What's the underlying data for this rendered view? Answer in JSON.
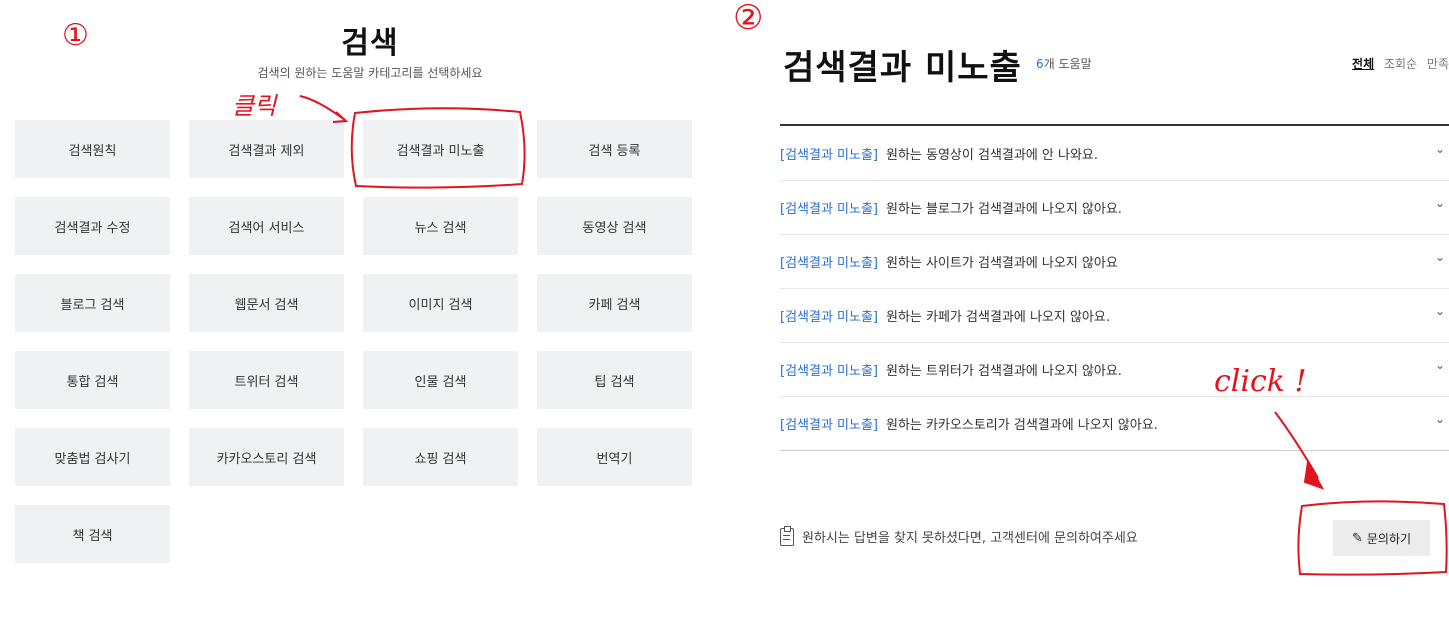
{
  "left": {
    "title": "검색",
    "subtitle": "검색의 원하는 도움말 카테고리를 선택하세요",
    "categories": [
      "검색원칙",
      "검색결과 제외",
      "검색결과 미노출",
      "검색 등록",
      "검색결과 수정",
      "검색어 서비스",
      "뉴스 검색",
      "동영상 검색",
      "블로그 검색",
      "웹문서 검색",
      "이미지 검색",
      "카페 검색",
      "통합 검색",
      "트위터 검색",
      "인물 검색",
      "팁 검색",
      "맞춤법 검사기",
      "카카오스토리 검색",
      "쇼핑 검색",
      "번역기",
      "책 검색"
    ]
  },
  "right": {
    "title": "검색결과 미노출",
    "count_number": "6",
    "count_suffix": "개 도움말",
    "sort": [
      "전체",
      "조회순",
      "만족"
    ],
    "tag": "[검색결과 미노출]",
    "items": [
      "원하는 동영상이 검색결과에 안 나와요.",
      "원하는 블로그가 검색결과에 나오지 않아요.",
      "원하는 사이트가 검색결과에 나오지 않아요",
      "원하는 카페가 검색결과에 나오지 않아요.",
      "원하는 트위터가 검색결과에 나오지 않아요.",
      "원하는 카카오스토리가 검색결과에 나오지 않아요."
    ],
    "help_text": "원하시는 답변을 찾지 못하셨다면, 고객센터에 문의하여주세요",
    "ask_button": "문의하기"
  },
  "annotations": {
    "step1": "①",
    "step2": "②",
    "click_ko": "클릭",
    "click_en": "click !",
    "color": "#e0141e"
  }
}
